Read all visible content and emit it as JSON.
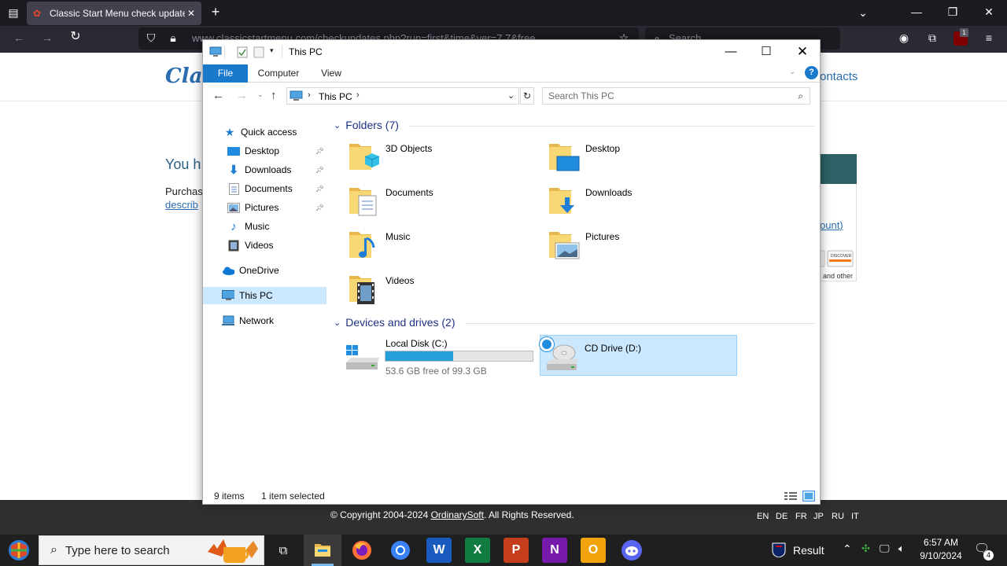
{
  "browser": {
    "tab_title": "Classic Start Menu check updates",
    "url": "www.classicstartmenu.com/checkupdates.php?run=first&time&ver=7.7&free",
    "search_placeholder": "Search",
    "extension_badge": "1"
  },
  "webpage": {
    "logo": "Clas",
    "contacts": "ontacts",
    "heading": "You h",
    "purchase_text": "Purchas",
    "describe_link": "describ",
    "account_link": "ount)",
    "cards_text": "and other",
    "copyright_prefix": "© Copyright 2004-2024 ",
    "copyright_link": "OrdinarySoft",
    "copyright_suffix": ". All Rights Reserved.",
    "languages": [
      "EN",
      "DE",
      "FR",
      "JP",
      "RU",
      "IT"
    ]
  },
  "explorer": {
    "title": "This PC",
    "ribbon_tabs": [
      "File",
      "Computer",
      "View"
    ],
    "address": "This PC",
    "search_placeholder": "Search This PC",
    "nav": {
      "quick_access": "Quick access",
      "quick_items": [
        "Desktop",
        "Downloads",
        "Documents",
        "Pictures",
        "Music",
        "Videos"
      ],
      "onedrive": "OneDrive",
      "this_pc": "This PC",
      "network": "Network"
    },
    "folders_header": "Folders (7)",
    "folders": [
      "3D Objects",
      "Desktop",
      "Documents",
      "Downloads",
      "Music",
      "Pictures",
      "Videos"
    ],
    "drives_header": "Devices and drives (2)",
    "drives": [
      {
        "name": "Local Disk (C:)",
        "free": "53.6 GB free of 99.3 GB",
        "used_fraction": 0.46
      },
      {
        "name": "CD Drive (D:)"
      }
    ],
    "status_items": "9 items",
    "status_selected": "1 item selected"
  },
  "taskbar": {
    "search_placeholder": "Type here to search",
    "weather_text": "Result",
    "time": "6:57 AM",
    "date": "9/10/2024",
    "notification_count": "4",
    "app_letters": {
      "word": "W",
      "excel": "X",
      "powerpoint": "P",
      "onenote": "N",
      "outlook": "O"
    }
  },
  "colors": {
    "accent": "#1979ca",
    "selection": "#cce8ff",
    "group_header": "#1e3287",
    "progress": "#26a0da"
  }
}
